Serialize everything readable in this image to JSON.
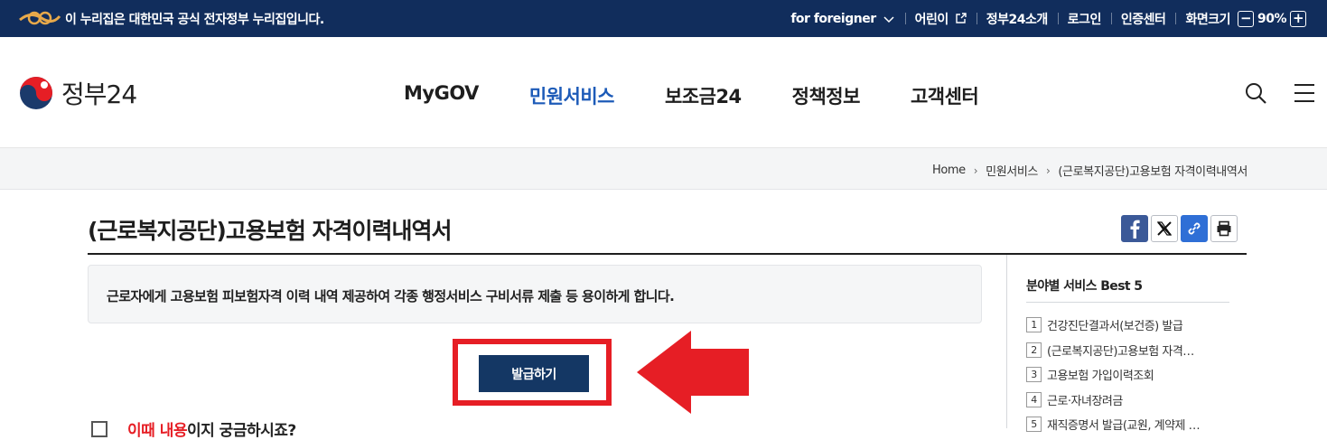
{
  "gov_banner": {
    "notice": "이 누리집은 대한민국 공식 전자정부 누리집입니다.",
    "utility": [
      {
        "label": "for foreigner",
        "icon": "chevron-down-icon"
      },
      {
        "label": "어린이",
        "icon": "external-link-icon"
      },
      {
        "label": "정부24소개"
      },
      {
        "label": "로그인"
      },
      {
        "label": "인증센터"
      }
    ],
    "zoom": {
      "label": "화면크기",
      "minus": "−",
      "value": "90%",
      "plus": "+"
    }
  },
  "header": {
    "logo_text": "정부24",
    "nav": [
      {
        "label": "MyGOV",
        "active": false
      },
      {
        "label": "민원서비스",
        "active": true
      },
      {
        "label": "보조금24",
        "active": false
      },
      {
        "label": "정책정보",
        "active": false
      },
      {
        "label": "고객센터",
        "active": false
      }
    ],
    "icons": [
      "search-icon",
      "menu-icon"
    ]
  },
  "breadcrumb": [
    "Home",
    "민원서비스",
    "(근로복지공단)고용보험 자격이력내역서"
  ],
  "page": {
    "title": "(근로복지공단)고용보험 자격이력내역서",
    "description": "근로자에게 고용보험 피보험자격 이력 내역 제공하여 각종 행정서비스 구비서류 제출 등 용이하게 합니다.",
    "issue_button": "발급하기",
    "faq": {
      "highlight": "이때 내용",
      "rest": "이지 궁금하시죠?"
    }
  },
  "share_icons": [
    "facebook-icon",
    "x-icon",
    "link-icon",
    "print-icon"
  ],
  "sidebar": {
    "title": "분야별 서비스 Best 5",
    "items": [
      {
        "num": "1",
        "label": "건강진단결과서(보건증) 발급"
      },
      {
        "num": "2",
        "label": "(근로복지공단)고용보험 자격…"
      },
      {
        "num": "3",
        "label": "고용보험 가입이력조회"
      },
      {
        "num": "4",
        "label": "근로·자녀장려금"
      },
      {
        "num": "5",
        "label": "재직증명서 발급(교원, 계약제 …"
      }
    ]
  },
  "colors": {
    "banner_bg": "#112d5c",
    "nav_active": "#1d5bb8",
    "button_bg": "#143764",
    "highlight_red": "#e61e25"
  }
}
